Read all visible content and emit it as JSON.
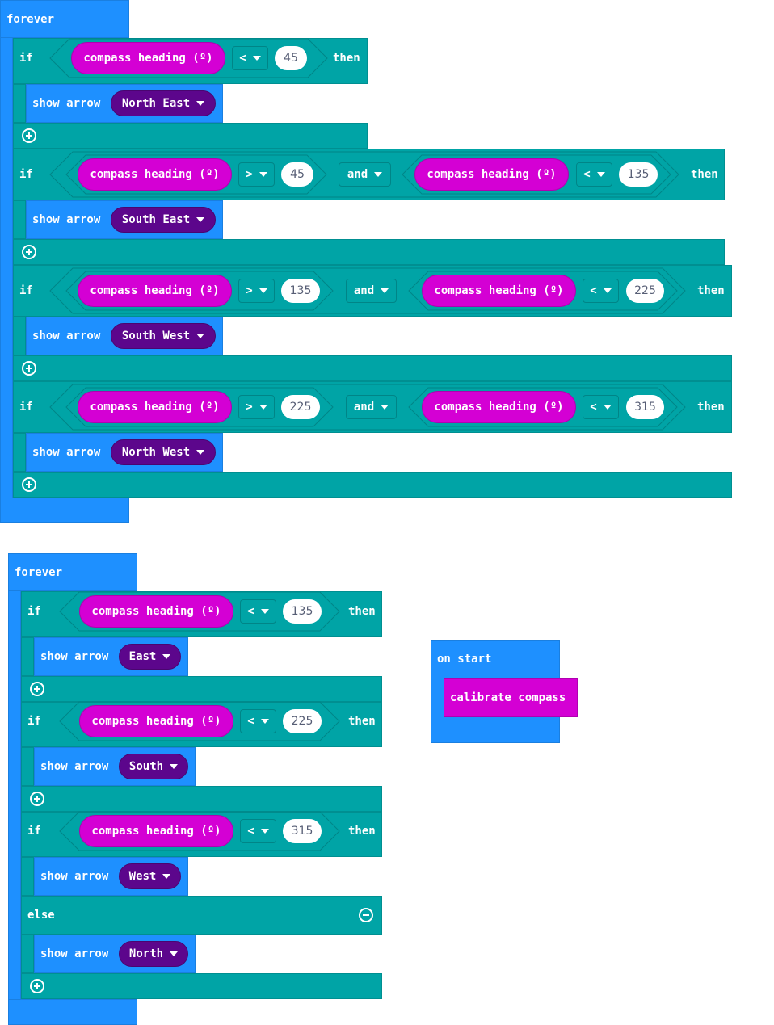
{
  "colors": {
    "events_blue": "#1E90FF",
    "logic_teal": "#00A4A6",
    "input_magenta": "#D400D4",
    "dropdown_purple": "#5C068C"
  },
  "workspace": [
    {
      "hat": "forever",
      "ifs": [
        {
          "keyword": "if",
          "conditions": [
            {
              "sensor": "compass heading (º)",
              "op": "<",
              "value": "45"
            }
          ],
          "then": "then",
          "action": {
            "label": "show arrow",
            "direction": "North East"
          }
        },
        {
          "keyword": "if",
          "conditions": [
            {
              "sensor": "compass heading (º)",
              "op": ">",
              "value": "45"
            },
            {
              "sensor": "compass heading (º)",
              "op": "<",
              "value": "135"
            }
          ],
          "joiner": "and",
          "then": "then",
          "action": {
            "label": "show arrow",
            "direction": "South East"
          }
        },
        {
          "keyword": "if",
          "conditions": [
            {
              "sensor": "compass heading (º)",
              "op": ">",
              "value": "135"
            },
            {
              "sensor": "compass heading (º)",
              "op": "<",
              "value": "225"
            }
          ],
          "joiner": "and",
          "then": "then",
          "action": {
            "label": "show arrow",
            "direction": "South West"
          }
        },
        {
          "keyword": "if",
          "conditions": [
            {
              "sensor": "compass heading (º)",
              "op": ">",
              "value": "225"
            },
            {
              "sensor": "compass heading (º)",
              "op": "<",
              "value": "315"
            }
          ],
          "joiner": "and",
          "then": "then",
          "action": {
            "label": "show arrow",
            "direction": "North West"
          }
        }
      ]
    },
    {
      "hat": "forever",
      "ifs": [
        {
          "keyword": "if",
          "conditions": [
            {
              "sensor": "compass heading (º)",
              "op": "<",
              "value": "135"
            }
          ],
          "then": "then",
          "action": {
            "label": "show arrow",
            "direction": "East"
          }
        },
        {
          "keyword": "if",
          "conditions": [
            {
              "sensor": "compass heading (º)",
              "op": "<",
              "value": "225"
            }
          ],
          "then": "then",
          "action": {
            "label": "show arrow",
            "direction": "South"
          }
        },
        {
          "keyword": "if",
          "conditions": [
            {
              "sensor": "compass heading (º)",
              "op": "<",
              "value": "315"
            }
          ],
          "then": "then",
          "action": {
            "label": "show arrow",
            "direction": "West"
          }
        }
      ],
      "else": {
        "keyword": "else",
        "action": {
          "label": "show arrow",
          "direction": "North"
        }
      }
    }
  ],
  "on_start": {
    "hat": "on start",
    "action": "calibrate compass"
  }
}
